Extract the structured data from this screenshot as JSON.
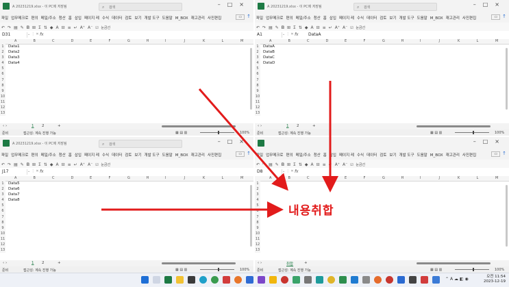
{
  "windows": {
    "tl": {
      "title": "A 20231219.xlsx - 이 PC에 저장됨",
      "search": "검색",
      "name_box": "D31",
      "formula_value": "",
      "cells": [
        "Data1",
        "Data2",
        "Data3",
        "Data4"
      ],
      "sheet_tabs": [
        "1",
        "2"
      ],
      "status_left": "준비",
      "status_access": "접근성: 계속 진행 가능",
      "zoom": "100%"
    },
    "tr": {
      "title": "A 20231219.xlsx - 이 PC에 저장됨",
      "search": "검색",
      "name_box": "A1",
      "formula_value": "DataA",
      "cells": [
        "DataA",
        "DataB",
        "DataC",
        "DataD"
      ],
      "sheet_tabs": [
        "1",
        "2"
      ],
      "status_left": "준비",
      "status_access": "접근성: 계속 진행 가능",
      "zoom": "100%"
    },
    "bl": {
      "title": "A 20231219.xlsx - 이 PC에 저장됨",
      "search": "검색",
      "name_box": "J17",
      "formula_value": "",
      "cells": [
        "Data5",
        "Data6",
        "Data7",
        "Data8"
      ],
      "sheet_tabs": [
        "1",
        "2"
      ],
      "status_left": "준비",
      "status_access": "접근성: 계속 진행 가능",
      "zoom": "100%"
    },
    "br": {
      "title": "",
      "search": "",
      "name_box": "D8",
      "formula_value": "",
      "cells": [],
      "sheet_tabs": [
        "취합"
      ],
      "status_left": "준비",
      "status_access": "접근성: 계속 진행 가능",
      "zoom": "100%"
    }
  },
  "menu": [
    "파일",
    "업무메크로",
    "편의",
    "메일/주소",
    "청산",
    "홈",
    "삽입",
    "페이지 레",
    "수식",
    "데이터",
    "검토",
    "보기",
    "개발 도구",
    "도움말",
    "M_BOX",
    "재고관리",
    "사진편집"
  ],
  "checkbox_label": "눈금선",
  "columns": [
    "A",
    "B",
    "C",
    "D",
    "E",
    "F",
    "G",
    "H",
    "I",
    "J",
    "K",
    "L",
    "M"
  ],
  "rows": [
    "1",
    "2",
    "3",
    "4",
    "5",
    "6",
    "7",
    "8",
    "9",
    "10",
    "11",
    "12",
    "13"
  ],
  "overlay_text": "내용취합",
  "clock": {
    "time": "오전 11:54",
    "date": "2023-12-19"
  },
  "tray_lang": "A",
  "colors": {
    "arrow": "#e21b1b",
    "excel_green": "#1d7a44"
  }
}
